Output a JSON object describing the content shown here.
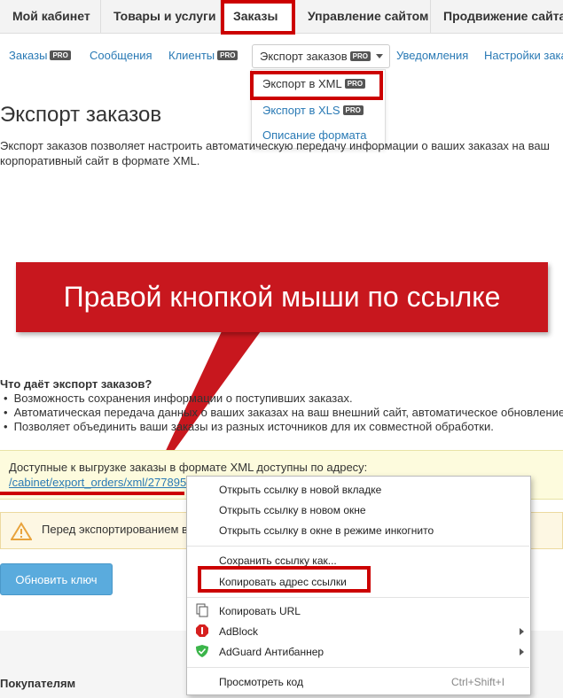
{
  "top_tabs": {
    "cabinet": "Мой кабинет",
    "products": "Товары и услуги",
    "orders": "Заказы",
    "site": "Управление сайтом",
    "promo": "Продвижение сайта"
  },
  "sub_nav": {
    "orders": "Заказы",
    "messages": "Сообщения",
    "clients": "Клиенты",
    "export": "Экспорт заказов",
    "notifications": "Уведомления",
    "settings": "Настройки заказ",
    "pro": "PRO"
  },
  "dropdown": {
    "xml": "Экспорт в XML",
    "xls": "Экспорт в XLS",
    "format": "Описание формата"
  },
  "page": {
    "title": "Экспорт заказов",
    "desc": "Экспорт заказов позволяет настроить автоматическую передачу информации о ваших заказах на ваш корпоративный сайт в формате XML."
  },
  "banner": "Правой кнопкой мыши по ссылке",
  "why": {
    "heading": "Что даёт экспорт заказов?",
    "items": [
      "Возможность сохранения информации о поступивших заказах.",
      "Автоматическая передача данных о ваших заказах на ваш внешний сайт, автоматическое обновление",
      "Позволяет объединить ваши заказы из разных источников для их совместной обработки."
    ]
  },
  "info": {
    "text": "Доступные к выгрузке заказы в формате XML доступны по адресу:",
    "link": "/cabinet/export_orders/xml/277895"
  },
  "warning": {
    "text": "Перед экспортированием в"
  },
  "update_button": "Обновить ключ",
  "buyers_heading": "Покупателям",
  "context_menu": {
    "open_tab": "Открыть ссылку в новой вкладке",
    "open_window": "Открыть ссылку в новом окне",
    "open_incognito": "Открыть ссылку в окне в режиме инкогнито",
    "save_link": "Сохранить ссылку как...",
    "copy_link": "Копировать адрес ссылки",
    "copy_url": "Копировать URL",
    "adblock": "AdBlock",
    "adguard": "AdGuard Антибаннер",
    "inspect": "Просмотреть код",
    "inspect_shortcut": "Ctrl+Shift+I"
  },
  "colors": {
    "highlight": "#c00",
    "link": "#2a7ab5",
    "banner": "#c8171e"
  }
}
